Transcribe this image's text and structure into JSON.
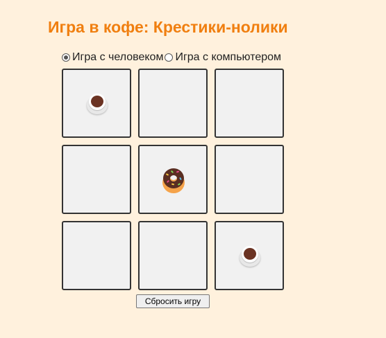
{
  "title": "Игра в кофе: Крестики-нолики",
  "modes": [
    {
      "label": "Игра с человеком",
      "selected": true
    },
    {
      "label": "Игра с компьютером",
      "selected": false
    }
  ],
  "board": {
    "cells": [
      "coffee",
      "",
      "",
      "",
      "donut",
      "",
      "",
      "",
      "coffee"
    ]
  },
  "icons": {
    "coffee": "coffee-cup-icon",
    "donut": "donut-icon"
  },
  "colors": {
    "background": "#fff1dd",
    "title": "#f07f10",
    "cell": "#f1f1f1",
    "cell_border": "#333333"
  },
  "reset_label": "Сбросить игру"
}
